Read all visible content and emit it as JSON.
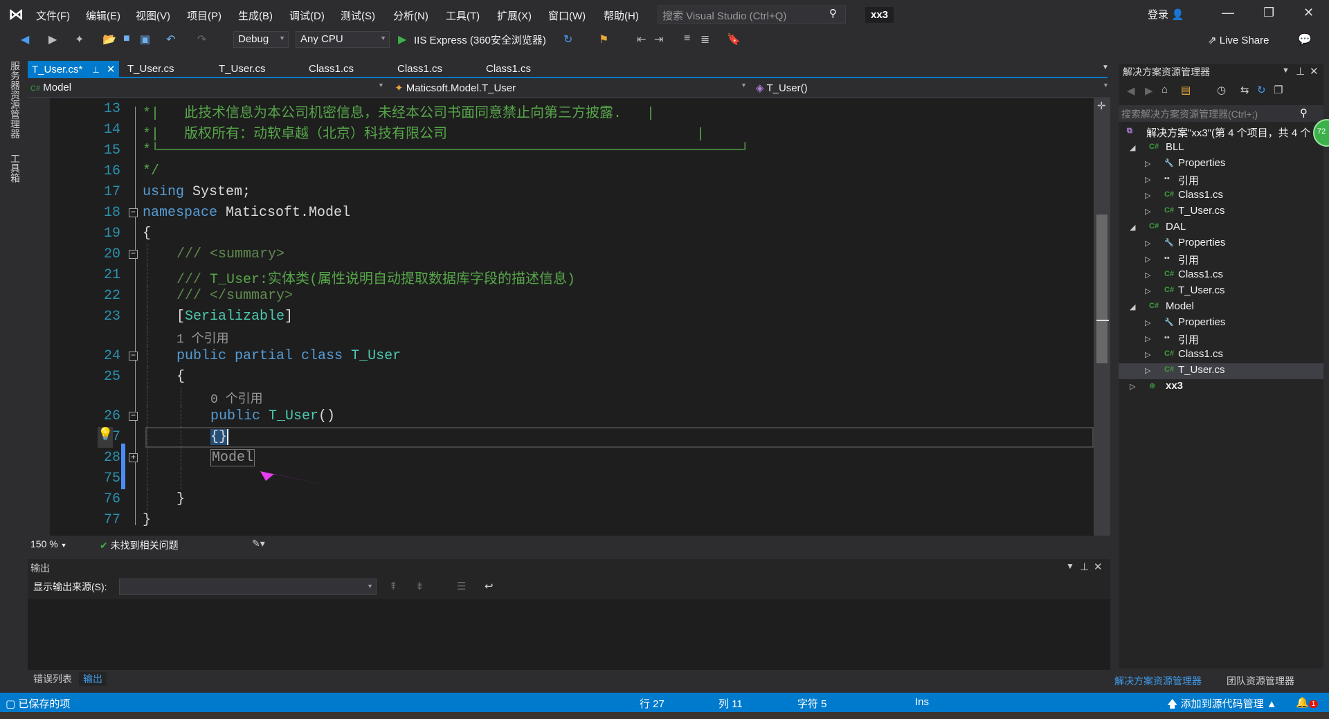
{
  "menubar": {
    "items": [
      "文件(F)",
      "编辑(E)",
      "视图(V)",
      "项目(P)",
      "生成(B)",
      "调试(D)",
      "测试(S)",
      "分析(N)",
      "工具(T)",
      "扩展(X)",
      "窗口(W)",
      "帮助(H)"
    ],
    "search_placeholder": "搜索 Visual Studio (Ctrl+Q)",
    "solution_title": "xx3",
    "login": "登录"
  },
  "toolbar": {
    "config": "Debug",
    "platform": "Any CPU",
    "run_target": "IIS Express (360安全浏览器)",
    "live_share": "Live Share"
  },
  "left_strip": [
    "服务器资源管理器",
    "工具箱"
  ],
  "tabs": [
    {
      "label": "T_User.cs*",
      "active": true
    },
    {
      "label": "T_User.cs"
    },
    {
      "label": "T_User.cs"
    },
    {
      "label": "Class1.cs"
    },
    {
      "label": "Class1.cs"
    },
    {
      "label": "Class1.cs"
    }
  ],
  "navbar": {
    "project": "Model",
    "type": "Maticsoft.Model.T_User",
    "member": "T_User()"
  },
  "editor": {
    "colors": {
      "comment": "#57a64a",
      "keyword": "#569cd6",
      "type": "#4ec9b0",
      "text": "#dcdcdc",
      "doc": "#608b4e",
      "linenum": "#2b91af"
    },
    "lines": [
      {
        "n": "13",
        "ind": 0,
        "tok": [
          [
            "*|   此技术信息为本公司机密信息，未经本公司书面同意禁止向第三方披露.   |",
            "comment"
          ]
        ]
      },
      {
        "n": "14",
        "ind": 0,
        "tok": [
          [
            "*|   版权所有：动软卓越（北京）科技有限公司                              |",
            "comment"
          ]
        ]
      },
      {
        "n": "15",
        "ind": 0,
        "tok": [
          [
            "*└──────────────────────────────────────────────────────────────────────┘",
            "comment"
          ]
        ]
      },
      {
        "n": "16",
        "ind": 0,
        "tok": [
          [
            "*/",
            "comment"
          ]
        ]
      },
      {
        "n": "17",
        "ind": 0,
        "tok": [
          [
            "using",
            "keyword"
          ],
          [
            " System;",
            "text"
          ]
        ]
      },
      {
        "n": "18",
        "ind": 0,
        "fold": "-",
        "tok": [
          [
            "namespace",
            "keyword"
          ],
          [
            " Maticsoft.Model",
            "text"
          ]
        ]
      },
      {
        "n": "19",
        "ind": 0,
        "tok": [
          [
            "{",
            "text"
          ]
        ]
      },
      {
        "n": "20",
        "ind": 1,
        "fold": "-",
        "tok": [
          [
            "/// <summary>",
            "doc"
          ]
        ]
      },
      {
        "n": "21",
        "ind": 1,
        "tok": [
          [
            "/// ",
            "doc"
          ],
          [
            "T_User:实体类(属性说明自动提取数据库字段的描述信息)",
            "comment"
          ]
        ]
      },
      {
        "n": "22",
        "ind": 1,
        "tok": [
          [
            "/// </summary>",
            "doc"
          ]
        ]
      },
      {
        "n": "23",
        "ind": 1,
        "tok": [
          [
            "[",
            "text"
          ],
          [
            "Serializable",
            "type"
          ],
          [
            "]",
            "text"
          ]
        ]
      },
      {
        "lens": "1 个引用",
        "ind": 1
      },
      {
        "n": "24",
        "ind": 1,
        "fold": "-",
        "tok": [
          [
            "public partial class",
            "keyword"
          ],
          [
            " ",
            "text"
          ],
          [
            "T_User",
            "type"
          ]
        ]
      },
      {
        "n": "25",
        "ind": 1,
        "tok": [
          [
            "{",
            "text"
          ]
        ]
      },
      {
        "lens": "0 个引用",
        "ind": 2
      },
      {
        "n": "26",
        "ind": 2,
        "fold": "-",
        "tok": [
          [
            "public",
            "keyword"
          ],
          [
            " ",
            "text"
          ],
          [
            "T_User",
            "type"
          ],
          [
            "()",
            "text"
          ]
        ]
      },
      {
        "n": "27",
        "ind": 2,
        "current": true,
        "tok": [
          [
            "{}",
            "sel"
          ]
        ]
      },
      {
        "n": "28",
        "ind": 2,
        "fold": "+",
        "collapsed": "Model"
      },
      {
        "n": "75",
        "ind": 2,
        "tok": []
      },
      {
        "n": "76",
        "ind": 1,
        "tok": [
          [
            "}",
            "text"
          ]
        ]
      },
      {
        "n": "77",
        "ind": 0,
        "tok": [
          [
            "}",
            "text"
          ]
        ]
      }
    ],
    "annotation_arrow_color": "#e83cf0"
  },
  "editor_status": {
    "zoom": "150 %",
    "issues": "未找到相关问题"
  },
  "output": {
    "title": "输出",
    "source_label": "显示输出来源(S):",
    "source_value": ""
  },
  "bottom_tabs": [
    "错误列表",
    "输出"
  ],
  "solution_explorer": {
    "title": "解决方案资源管理器",
    "search_placeholder": "搜索解决方案资源管理器(Ctrl+;)",
    "root": "解决方案\"xx3\"(第 4 个项目，共 4 个",
    "items": [
      {
        "label": "BLL",
        "level": 1,
        "kind": "project",
        "expanded": true
      },
      {
        "label": "Properties",
        "level": 2,
        "kind": "wrench"
      },
      {
        "label": "引用",
        "level": 2,
        "kind": "ref"
      },
      {
        "label": "Class1.cs",
        "level": 2,
        "kind": "cs"
      },
      {
        "label": "T_User.cs",
        "level": 2,
        "kind": "cs"
      },
      {
        "label": "DAL",
        "level": 1,
        "kind": "project",
        "expanded": true
      },
      {
        "label": "Properties",
        "level": 2,
        "kind": "wrench"
      },
      {
        "label": "引用",
        "level": 2,
        "kind": "ref"
      },
      {
        "label": "Class1.cs",
        "level": 2,
        "kind": "cs"
      },
      {
        "label": "T_User.cs",
        "level": 2,
        "kind": "cs"
      },
      {
        "label": "Model",
        "level": 1,
        "kind": "project",
        "expanded": true
      },
      {
        "label": "Properties",
        "level": 2,
        "kind": "wrench"
      },
      {
        "label": "引用",
        "level": 2,
        "kind": "ref"
      },
      {
        "label": "Class1.cs",
        "level": 2,
        "kind": "cs"
      },
      {
        "label": "T_User.cs",
        "level": 2,
        "kind": "cs",
        "selected": true
      },
      {
        "label": "xx3",
        "level": 1,
        "kind": "web",
        "bold": true
      }
    ],
    "badge": "72",
    "bottom_tabs": [
      "解决方案资源管理器",
      "团队资源管理器"
    ]
  },
  "statusbar": {
    "saved": "已保存的项",
    "row": "行 27",
    "col": "列 11",
    "char": "字符 5",
    "mode": "Ins",
    "source_control": "添加到源代码管理 ▲",
    "notifications": "1"
  }
}
